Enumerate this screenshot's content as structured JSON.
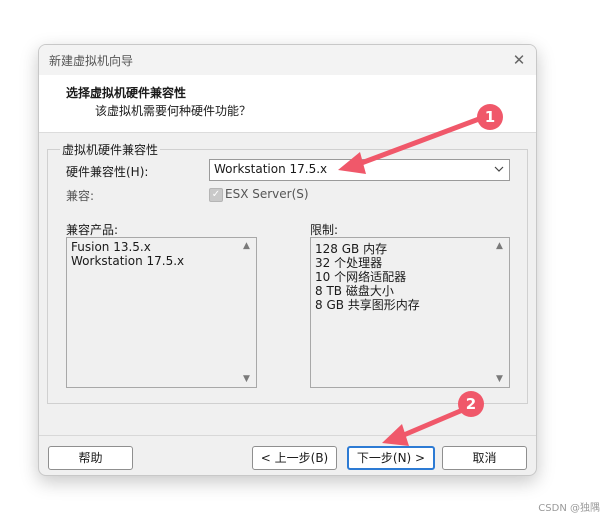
{
  "window": {
    "title": "新建虚拟机向导",
    "close_glyph": "✕"
  },
  "header": {
    "title": "选择虚拟机硬件兼容性",
    "subtitle": "该虚拟机需要何种硬件功能？"
  },
  "group": {
    "legend": "虚拟机硬件兼容性",
    "compat_label": "硬件兼容性(H):",
    "compat_value": "Workstation 17.5.x",
    "compatible_label": "兼容:",
    "esx_label": "ESX Server(S)"
  },
  "products": {
    "label": "兼容产品:",
    "items": [
      "Fusion 13.5.x",
      "Workstation 17.5.x"
    ]
  },
  "limits": {
    "label": "限制:",
    "items": [
      "128 GB 内存",
      "32 个处理器",
      "10 个网络适配器",
      "8 TB 磁盘大小",
      "8 GB 共享图形内存"
    ]
  },
  "footer": {
    "help": "帮助",
    "back": "< 上一步(B)",
    "next": "下一步(N) >",
    "cancel": "取消"
  },
  "annotations": {
    "one": "1",
    "two": "2",
    "color": "#f0586a"
  },
  "watermark": "CSDN @独隅"
}
